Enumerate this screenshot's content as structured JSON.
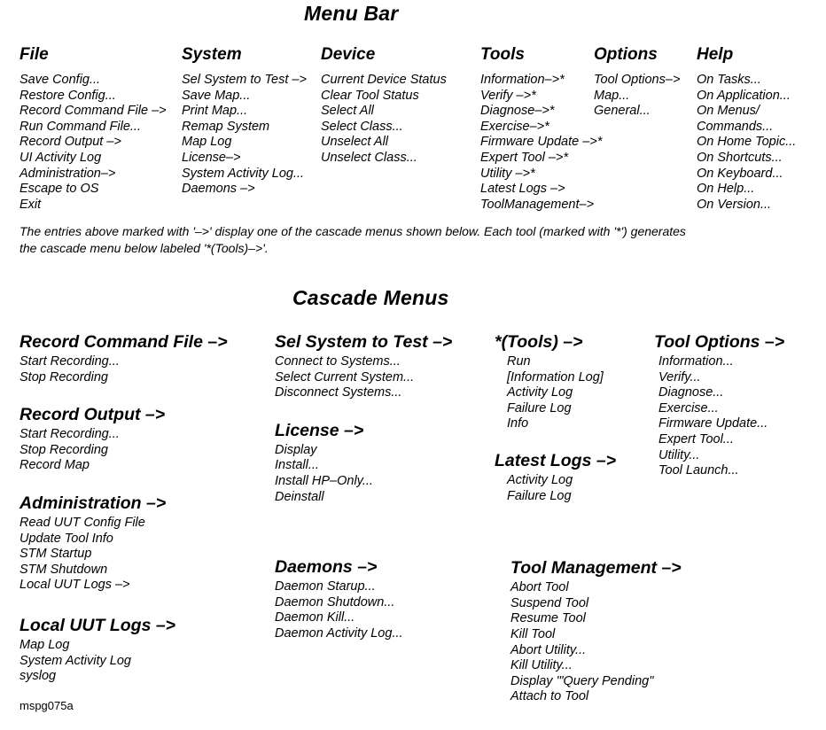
{
  "figure": {
    "id_label": "mspg075a"
  },
  "menu_bar": {
    "title": "Menu Bar",
    "note_lines": [
      "The entries above marked with '–>' display one of the cascade menus shown below.  Each tool (marked with '*') generates",
      "the cascade menu below labeled '*(Tools)–>'."
    ],
    "columns": [
      {
        "name": "File",
        "label": "File",
        "items": [
          "Save Config...",
          "Restore Config...",
          "Record Command File –>",
          "Run Command File...",
          "Record Output –>",
          "UI Activity Log",
          "Administration–>",
          "Escape to OS",
          "Exit"
        ]
      },
      {
        "name": "System",
        "label": "System",
        "items": [
          "Sel System to Test –>",
          "Save Map...",
          "Print Map...",
          "Remap System",
          "Map Log",
          "License–>",
          "System Activity Log...",
          "Daemons –>"
        ]
      },
      {
        "name": "Device",
        "label": "Device",
        "items": [
          "Current Device Status",
          "Clear Tool Status",
          "Select All",
          "Select Class...",
          "Unselect All",
          "Unselect Class..."
        ]
      },
      {
        "name": "Tools",
        "label": "Tools",
        "items": [
          "Information–>*",
          "Verify –>*",
          "Diagnose–>*",
          "Exercise–>*",
          "Firmware Update –>*",
          "Expert Tool –>*",
          "Utility –>*",
          "Latest Logs –>",
          "ToolManagement–>"
        ]
      },
      {
        "name": "Options",
        "label": "Options",
        "items": [
          "Tool Options–>",
          "Map...",
          "General..."
        ]
      },
      {
        "name": "Help",
        "label": "Help",
        "items": [
          "On Tasks...",
          "On Application...",
          "On Menus/",
          "Commands...",
          "On Home Topic...",
          "On Shortcuts...",
          "On Keyboard...",
          "On Help...",
          "On Version..."
        ]
      }
    ]
  },
  "cascade_menus": {
    "title": "Cascade Menus",
    "column1": [
      {
        "name": "record-command-file",
        "head": "Record Command File –>",
        "items": [
          "Start Recording...",
          "Stop Recording"
        ]
      },
      {
        "name": "record-output",
        "head": "Record Output –>",
        "items": [
          "Start Recording...",
          "Stop Recording",
          "Record Map"
        ]
      },
      {
        "name": "administration",
        "head": "Administration –>",
        "items": [
          "Read UUT Config File",
          "Update Tool Info",
          "STM Startup",
          "STM Shutdown",
          "Local UUT Logs –>"
        ]
      },
      {
        "name": "local-uut-logs",
        "head": "Local UUT Logs –>",
        "items": [
          "Map Log",
          "System Activity Log",
          "syslog"
        ]
      }
    ],
    "column2": [
      {
        "name": "sel-system-to-test",
        "head": "Sel System to Test –>",
        "items": [
          "Connect to Systems...",
          "Select Current System...",
          "Disconnect Systems..."
        ]
      },
      {
        "name": "license",
        "head": "License –>",
        "items": [
          "Display",
          "Install...",
          "Install HP–Only...",
          "Deinstall"
        ]
      },
      {
        "name": "daemons",
        "head": "Daemons –>",
        "items": [
          "Daemon Starup...",
          "Daemon Shutdown...",
          "Daemon Kill...",
          "Daemon Activity Log..."
        ]
      }
    ],
    "column3": [
      {
        "name": "tools-cascade",
        "head": "*(Tools) –>",
        "items": [
          "Run",
          "[Information Log]",
          "Activity Log",
          "Failure Log",
          "Info"
        ]
      },
      {
        "name": "latest-logs",
        "head": "Latest Logs –>",
        "items": [
          "Activity Log",
          "Failure Log"
        ]
      },
      {
        "name": "tool-management",
        "head": "Tool Management –>",
        "items": [
          "Abort Tool",
          "Suspend Tool",
          "Resume Tool",
          "Kill Tool",
          "Abort Utility...",
          "Kill Utility...",
          "Display '\"Query Pending\"",
          "Attach to Tool"
        ]
      }
    ],
    "column4": [
      {
        "name": "tool-options",
        "head": "Tool Options –>",
        "items": [
          "Information...",
          "Verify...",
          "Diagnose...",
          "Exercise...",
          "Firmware Update...",
          "Expert Tool...",
          "Utility...",
          "Tool Launch..."
        ]
      }
    ]
  }
}
